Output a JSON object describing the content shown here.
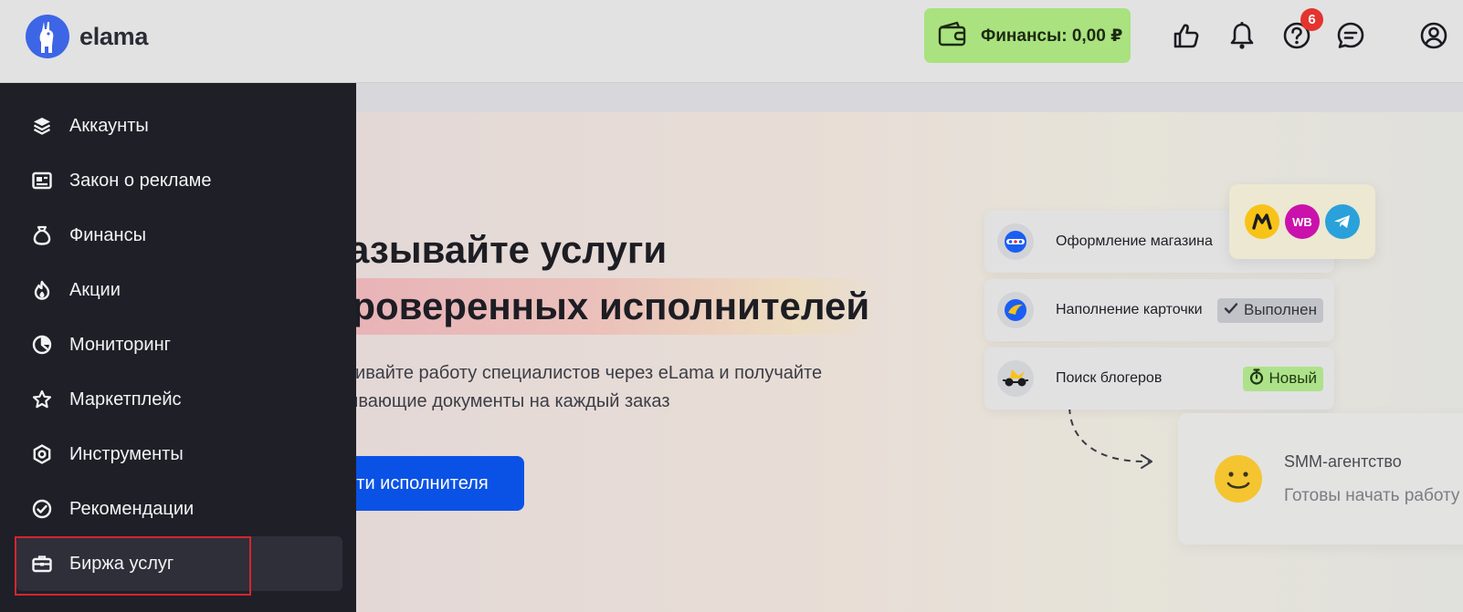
{
  "header": {
    "logo_text": "elama",
    "finance_button": "Финансы: 0,00 ₽",
    "help_badge": "6",
    "icons": [
      "like-icon",
      "bell-icon",
      "help-icon",
      "chat-icon",
      "profile-icon"
    ]
  },
  "sidebar": {
    "items": [
      {
        "label": "Аккаунты",
        "icon": "layers-icon"
      },
      {
        "label": "Закон о рекламе",
        "icon": "id-card-icon"
      },
      {
        "label": "Финансы",
        "icon": "money-bag-icon"
      },
      {
        "label": "Акции",
        "icon": "fire-icon"
      },
      {
        "label": "Мониторинг",
        "icon": "pie-chart-icon"
      },
      {
        "label": "Маркетплейс",
        "icon": "star-icon"
      },
      {
        "label": "Инструменты",
        "icon": "gear-icon"
      },
      {
        "label": "Рекомендации",
        "icon": "check-badge-icon"
      },
      {
        "label": "Биржа услуг",
        "icon": "briefcase-icon",
        "active": true
      }
    ]
  },
  "hero": {
    "title_line1": "казывайте услуги",
    "title_line2": "проверенных исполнителей",
    "desc_line1": "нивайте работу специалистов через eLama и получайте",
    "desc_line2": "ывающие документы на каждый заказ",
    "cta": "айти исполнителя"
  },
  "tasks": [
    {
      "label": "Оформление магазина",
      "icon": "ozon-icon"
    },
    {
      "label": "Наполнение карточки",
      "status": "Выполнен",
      "status_type": "done",
      "icon": "lamoda-icon"
    },
    {
      "label": "Поиск блогеров",
      "status": "Новый",
      "status_type": "new",
      "icon": "blogger-icon"
    }
  ],
  "brands": {
    "wb_text": "WB",
    "colors": {
      "yandex": "#f8c318",
      "wildberries": "#cb11ab",
      "telegram": "#2aa1da"
    }
  },
  "agency_card": {
    "title": "SMM-агентство",
    "subtitle": "Готовы начать работу"
  },
  "colors": {
    "accent_blue": "#0a52e6",
    "finance_green": "#a9e27f",
    "sidebar_bg": "#1f2027",
    "badge_red": "#e3342f"
  }
}
